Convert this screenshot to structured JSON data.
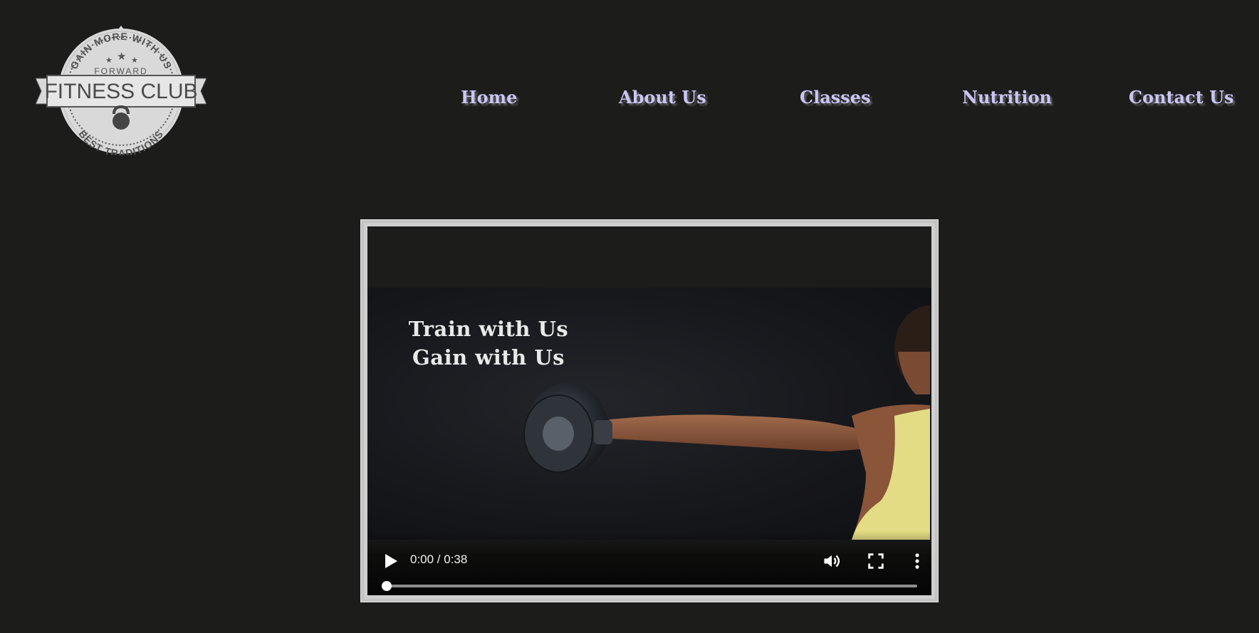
{
  "logo": {
    "top_text": "GAIN MORE WITH US",
    "middle_text": "FORWARD",
    "banner_text": "FITNESS CLUB",
    "bottom_text": "BEST TRADITIONS"
  },
  "nav": {
    "items": [
      {
        "label": "Home"
      },
      {
        "label": "About Us"
      },
      {
        "label": "Classes"
      },
      {
        "label": "Nutrition"
      },
      {
        "label": "Contact Us"
      }
    ]
  },
  "video": {
    "overlay_line1": "Train with Us",
    "overlay_line2": "Gain with Us",
    "time": "0:00 / 0:38",
    "progress": 0
  },
  "colors": {
    "background": "#1c1c1b",
    "nav_text": "#c9c6f4",
    "frame_border": "#c4c4c4"
  }
}
